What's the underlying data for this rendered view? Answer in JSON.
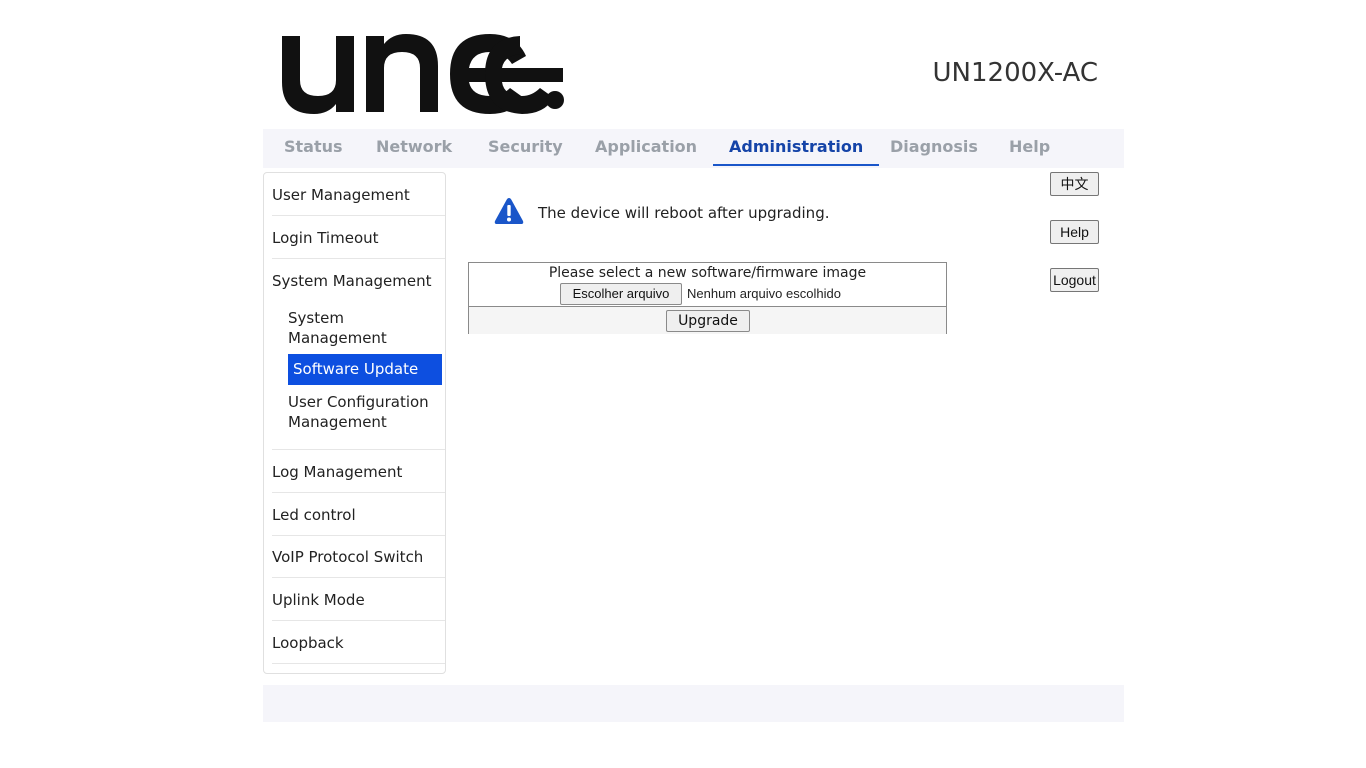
{
  "header": {
    "logo_text": "unee.",
    "model": "UN1200X-AC"
  },
  "nav": {
    "tabs": [
      {
        "label": "Status"
      },
      {
        "label": "Network"
      },
      {
        "label": "Security"
      },
      {
        "label": "Application"
      },
      {
        "label": "Administration",
        "active": true
      },
      {
        "label": "Diagnosis"
      },
      {
        "label": "Help"
      }
    ]
  },
  "sidebar": {
    "items": [
      {
        "label": "User Management"
      },
      {
        "label": "Login Timeout"
      },
      {
        "label": "System Management"
      },
      {
        "label": "Log Management"
      },
      {
        "label": "Led control"
      },
      {
        "label": "VoIP Protocol Switch"
      },
      {
        "label": "Uplink Mode"
      },
      {
        "label": "Loopback"
      }
    ],
    "subitems": [
      {
        "label": "System Management"
      },
      {
        "label": "Software Update",
        "active": true
      },
      {
        "label": "User Configuration Management"
      }
    ]
  },
  "main": {
    "warning_icon": "warning-triangle-icon",
    "warning_text": "The device will reboot after upgrading.",
    "upload": {
      "title": "Please select a new software/firmware image",
      "file_button": "Escolher arquivo",
      "file_status": "Nenhum arquivo escolhido",
      "upgrade_button": "Upgrade"
    }
  },
  "side_buttons": {
    "language": "中文",
    "help": "Help",
    "logout": "Logout"
  },
  "colors": {
    "accent": "#0d4fe0",
    "nav_active": "#1544a8",
    "nav_inactive": "#9aa0a8",
    "warning": "#1a56c9"
  }
}
